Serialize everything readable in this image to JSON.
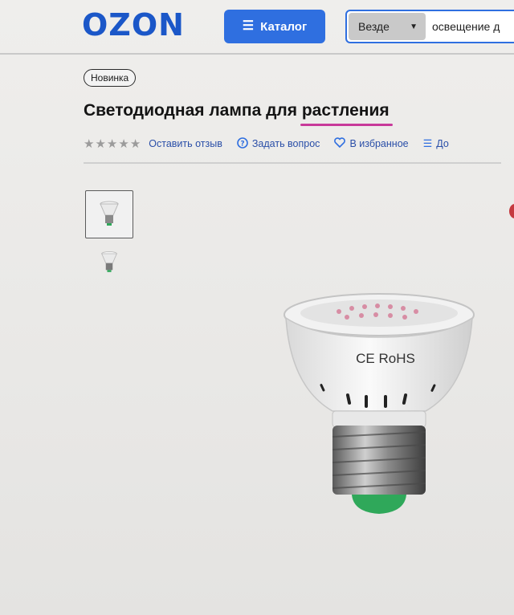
{
  "header": {
    "logo": "OZON",
    "catalog_label": "Каталог",
    "catalog_icon": "menu-lines-icon",
    "search_scope": "Везде",
    "search_value": "освещение д"
  },
  "product": {
    "badge": "Новинка",
    "title_main": "Светодиодная лампа для ",
    "title_highlight": "растления",
    "rating_stars": 0,
    "actions": {
      "review": "Оставить отзыв",
      "question": "Задать вопрос",
      "favorite": "В избранное",
      "compare": "До"
    },
    "lamp_marking": "CE RoHS"
  },
  "colors": {
    "brand": "#1b57c8",
    "button": "#2f6fe0",
    "highlight_underline": "#c8399a",
    "lamp_base_green": "#2fa85a"
  }
}
